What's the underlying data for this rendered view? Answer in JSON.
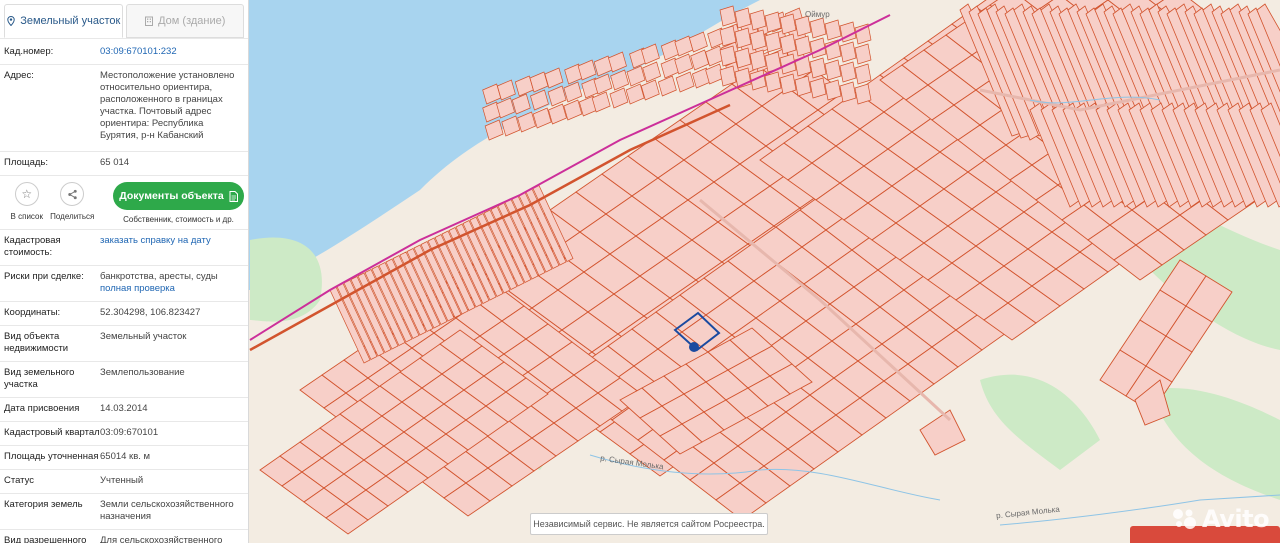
{
  "tabs": [
    {
      "label": "Земельный участок",
      "icon": "map-pin-icon",
      "active": true
    },
    {
      "label": "Дом (здание)",
      "icon": "building-icon",
      "active": false
    }
  ],
  "top_rows": [
    {
      "key": "Кад.номер:",
      "value": "03:09:670101:232",
      "link": true
    },
    {
      "key": "Адрес:",
      "value": "Местоположение установлено относительно ориентира, расположенного в границах участка. Почтовый адрес ориентира: Республика Бурятия, р-н Кабанский"
    },
    {
      "key": "Площадь:",
      "value": "65 014"
    }
  ],
  "actions": {
    "favorite_label": "В список",
    "share_label": "Поделиться",
    "docs_label": "Документы объекта",
    "docs_sub": "Собственник, стоимость и др."
  },
  "cad_cost": {
    "key": "Кадастровая стоимость:",
    "link": "заказать справку на дату"
  },
  "risks": {
    "key": "Риски при сделке:",
    "value": "банкротства, аресты, суды",
    "link": "полная проверка"
  },
  "rows": [
    {
      "key": "Координаты:",
      "value": "52.304298, 106.823427"
    },
    {
      "key": "Вид объекта недвижимости",
      "value": "Земельный участок"
    },
    {
      "key": "Вид земельного участка",
      "value": "Землепользование"
    },
    {
      "key": "Дата присвоения",
      "value": "14.03.2014"
    },
    {
      "key": "Кадастровый квартал",
      "value": "03:09:670101"
    },
    {
      "key": "Площадь уточненная",
      "value": "65014 кв. м"
    },
    {
      "key": "Статус",
      "value": "Учтенный"
    },
    {
      "key": "Категория земель",
      "value": "Земли сельскохозяйственного назначения"
    },
    {
      "key": "Вид разрешенного использования",
      "value": "Для сельскохозяйственного производства"
    }
  ],
  "map": {
    "notice": "Независимый сервис. Не является сайтом Росреестра.",
    "watermark": "Avito",
    "labels": [
      "р. Сырая Молька",
      "р. Сырая Молька",
      "Оймур"
    ],
    "colors": {
      "water": "#a8d4ef",
      "parcel_fill": "#f7cfc8",
      "parcel_line": "#d2542e",
      "green": "#cdeac6",
      "road": "#cc2f9a",
      "selected": "#1a4aa0"
    }
  }
}
